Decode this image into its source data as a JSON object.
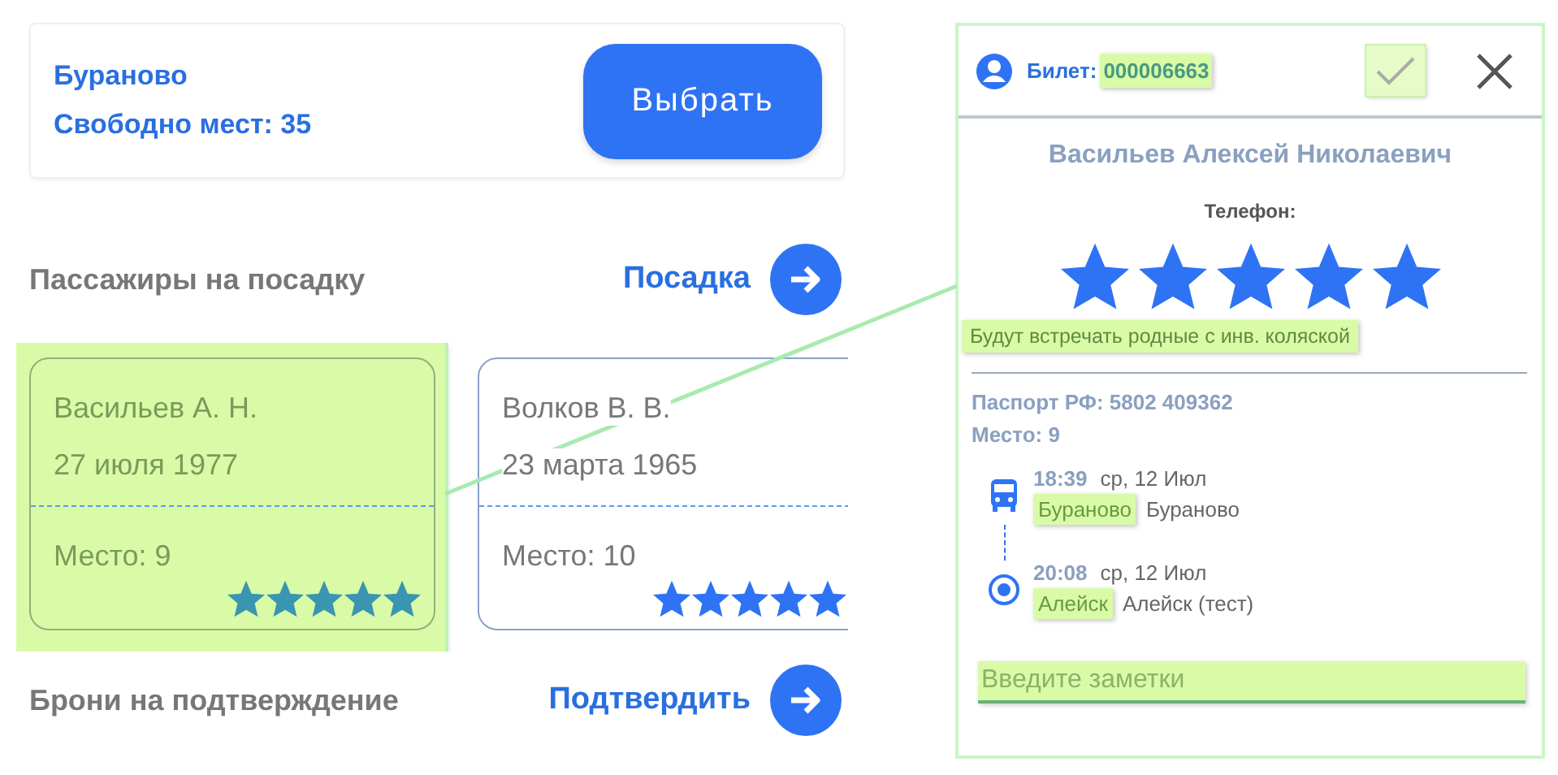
{
  "station": {
    "name": "Бураново",
    "free_seats": "Свободно мест: 35"
  },
  "select_button": "Выбрать",
  "boarding": {
    "title": "Пассажиры на посадку",
    "action": "Посадка"
  },
  "passengers": [
    {
      "name": "Васильев А. Н.",
      "birth_date": "27 июля 1977",
      "seat": "Место: 9",
      "stars": 5,
      "highlighted": true
    },
    {
      "name": "Волков В. В.",
      "birth_date": "23 марта 1965",
      "seat": "Место: 10",
      "stars": 5,
      "highlighted": false
    }
  ],
  "confirmations": {
    "title": "Брони на подтверждение",
    "action": "Подтвердить"
  },
  "ticket": {
    "label": "Билет:",
    "number": "000006663",
    "number_highlighted": true,
    "confirm_highlighted": true,
    "passenger_name": "Васильев Алексей Николаевич",
    "phone_label": "Телефон:",
    "stars": 5,
    "note": "Будут встречать родные с инв. коляской",
    "note_highlighted": true,
    "passport": "Паспорт РФ: 5802 409362",
    "seat": "Место: 9",
    "route": [
      {
        "kind": "departure",
        "time": "18:39",
        "date": "ср, 12 Июл",
        "stop": "Бураново",
        "stop_highlighted": true,
        "place": "Бураново"
      },
      {
        "kind": "arrival",
        "time": "20:08",
        "date": "ср, 12 Июл",
        "stop": "Алейск",
        "stop_highlighted": true,
        "place": "Алейск (тест)"
      }
    ],
    "notes": {
      "placeholder": "Введите заметки",
      "highlighted": true
    }
  }
}
